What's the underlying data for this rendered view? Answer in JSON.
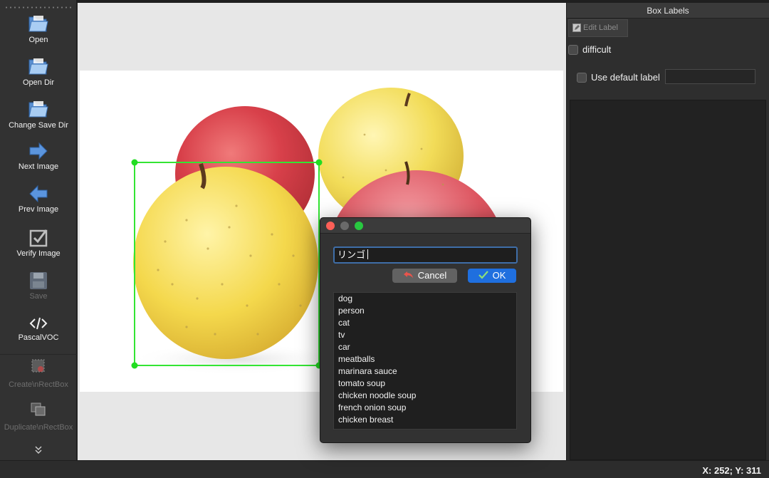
{
  "toolbar": {
    "items": [
      {
        "label": "Open",
        "icon": "folder-icon",
        "enabled": true
      },
      {
        "label": "Open Dir",
        "icon": "folder-icon",
        "enabled": true
      },
      {
        "label": "Change Save Dir",
        "icon": "folder-icon",
        "enabled": true
      },
      {
        "label": "Next Image",
        "icon": "arrow-right-icon",
        "enabled": true
      },
      {
        "label": "Prev Image",
        "icon": "arrow-left-icon",
        "enabled": true
      },
      {
        "label": "Verify Image",
        "icon": "checkbox-icon",
        "enabled": true
      },
      {
        "label": "Save",
        "icon": "floppy-disk-icon",
        "enabled": false
      },
      {
        "label": "PascalVOC",
        "icon": "code-tag-icon",
        "enabled": true
      },
      {
        "label": "Create\\nRectBox",
        "icon": "create-rect-icon",
        "enabled": false
      },
      {
        "label": "Duplicate\\nRectBox",
        "icon": "duplicate-rect-icon",
        "enabled": false
      }
    ]
  },
  "dock": {
    "title": "Box Labels",
    "edit_label": "Edit Label",
    "difficult_label": "difficult",
    "use_default_label": "Use default label",
    "default_label_value": ""
  },
  "status": {
    "coords": "X: 252; Y: 311"
  },
  "dialog": {
    "input_value": "リンゴ",
    "cancel_label": "Cancel",
    "ok_label": "OK",
    "labels": [
      "dog",
      "person",
      "cat",
      "tv",
      "car",
      "meatballs",
      "marinara sauce",
      "tomato soup",
      "chicken noodle soup",
      "french onion soup",
      "chicken breast"
    ]
  },
  "colors": {
    "bbox": "#33e533",
    "ok_button": "#1f6fdf",
    "close_light": "#fe5f57",
    "minimize_light": "#6a6a6a",
    "zoom_light": "#28c840"
  }
}
